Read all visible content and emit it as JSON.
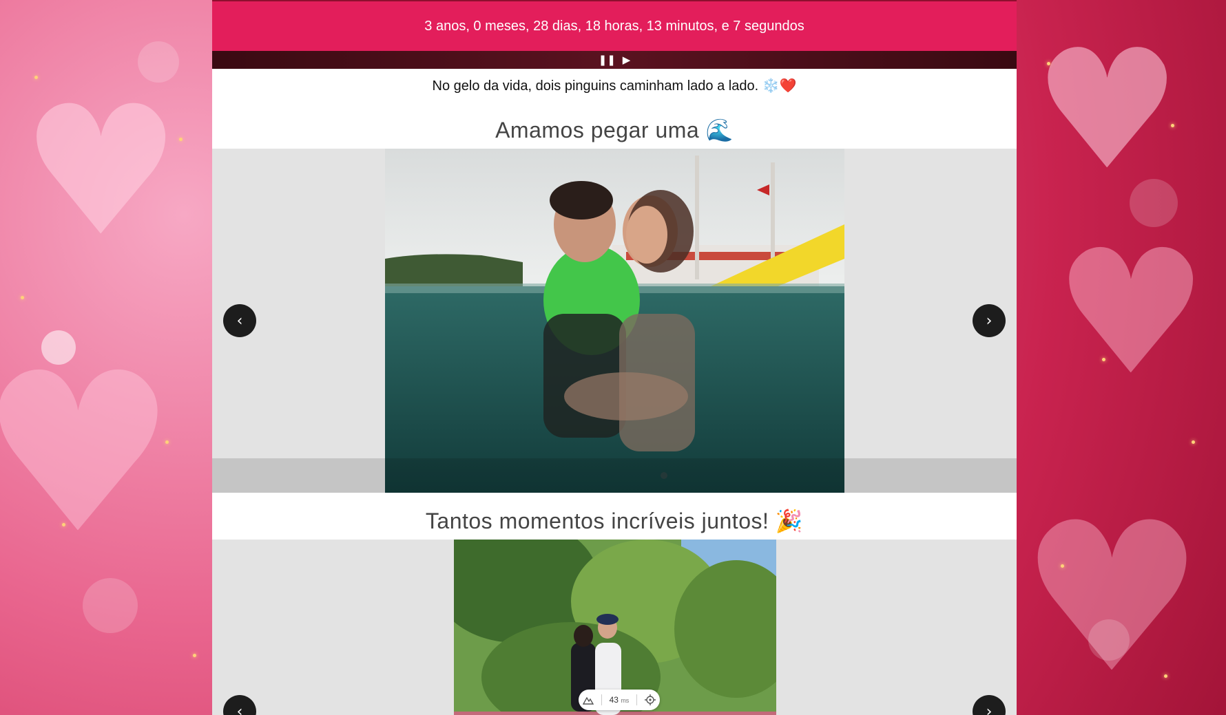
{
  "counter": {
    "text": "3 anos, 0 meses, 28 dias, 18 horas, 13 minutos, e 7 segundos"
  },
  "music": {
    "pause_icon": "❚❚",
    "play_icon": "▶"
  },
  "subtitle": {
    "text": "No gelo da vida, dois pinguins caminham lado a lado. ❄️❤️"
  },
  "sections": [
    {
      "title": "Amamos pegar uma 🌊",
      "prev": "‹",
      "next": "›"
    },
    {
      "title": "Tantos momentos incríveis juntos! 🎉",
      "prev": "‹",
      "next": "›"
    }
  ],
  "perf": {
    "value": "43",
    "unit": "ms"
  },
  "colors": {
    "accent": "#e31e5b",
    "carousel_bg": "#e3e3e3"
  }
}
